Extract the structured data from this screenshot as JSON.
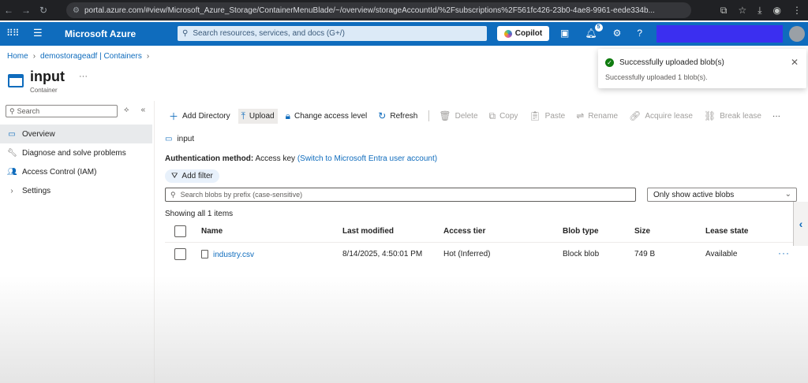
{
  "browser": {
    "url": "portal.azure.com/#view/Microsoft_Azure_Storage/ContainerMenuBlade/~/overview/storageAccountId/%2Fsubscriptions%2F561fc426-23b0-4ae8-9961-eede334b..."
  },
  "topbar": {
    "brand": "Microsoft Azure",
    "search_placeholder": "Search resources, services, and docs (G+/)",
    "copilot_label": "Copilot",
    "notification_count": "5"
  },
  "breadcrumb": {
    "home": "Home",
    "parent": "demostorageadf | Containers"
  },
  "page": {
    "title": "input",
    "subtitle": "Container",
    "more": "···"
  },
  "toast": {
    "title": "Successfully uploaded blob(s)",
    "body": "Successfully uploaded 1 blob(s)."
  },
  "leftnav": {
    "search_placeholder": "Search",
    "items": [
      {
        "label": "Overview"
      },
      {
        "label": "Diagnose and solve problems"
      },
      {
        "label": "Access Control (IAM)"
      },
      {
        "label": "Settings"
      }
    ]
  },
  "toolbar": {
    "add_directory": "Add Directory",
    "upload": "Upload",
    "change_access": "Change access level",
    "refresh": "Refresh",
    "delete": "Delete",
    "copy": "Copy",
    "paste": "Paste",
    "rename": "Rename",
    "acquire_lease": "Acquire lease",
    "break_lease": "Break lease",
    "more": "···"
  },
  "content": {
    "path": "input",
    "auth_label": "Authentication method:",
    "auth_value": "Access key",
    "auth_switch": "(Switch to Microsoft Entra user account)",
    "add_filter": "Add filter",
    "blob_search_placeholder": "Search blobs by prefix (case-sensitive)",
    "blob_filter_value": "Only show active blobs",
    "showing": "Showing all 1 items"
  },
  "table": {
    "columns": [
      "Name",
      "Last modified",
      "Access tier",
      "Blob type",
      "Size",
      "Lease state"
    ],
    "rows": [
      {
        "name": "industry.csv",
        "last_modified": "8/14/2025, 4:50:01 PM",
        "access_tier": "Hot (Inferred)",
        "blob_type": "Block blob",
        "size": "749 B",
        "lease_state": "Available"
      }
    ]
  },
  "colors": {
    "azure_blue": "#0f6cbd",
    "success_green": "#107c10"
  }
}
